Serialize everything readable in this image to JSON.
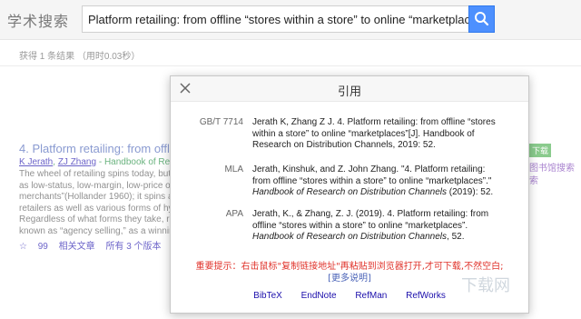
{
  "header": {
    "logo": "学术搜索",
    "search_value": "Platform retailing: from offline “stores within a store” to online “marketplaces” online"
  },
  "stats": "获得 1 条结果 （用时0.03秒）",
  "result": {
    "title": "4. Platform retailing: from offli",
    "authors": [
      "K Jerath",
      "ZJ Zhang"
    ],
    "source": " - Handbook of Rese",
    "snippet": [
      "The wheel of retailing spins today, but",
      "as low-status, low-margin, low-price op",
      "merchants”(Hollander 1960); it spins a",
      "retailers as well as various forms of hy",
      "Regardless of what forms they take, r",
      "known as “agency selling,” as a winnin"
    ],
    "actions": [
      "☆",
      "99",
      "相关文章",
      "所有 3 个版本"
    ],
    "side_badge": "下载",
    "side_link": "图书馆搜索",
    "side_link2": "索"
  },
  "modal": {
    "title": "引用",
    "citations": [
      {
        "format": "GB/T 7714",
        "lines": [
          "Jerath K, Zhang Z J. 4. Platform retailing: from offline “stores",
          "within a store” to online “marketplaces”[J]. Handbook of",
          "Research on Distribution Channels, 2019: 52."
        ]
      },
      {
        "format": "MLA",
        "lines": [
          "Jerath, Kinshuk, and Z. John Zhang. \"4. Platform retailing:",
          "from offline “stores within a store” to online “marketplaces”.\""
        ],
        "italic_line": "Handbook of Research on Distribution Channels",
        "italic_suffix": " (2019): 52."
      },
      {
        "format": "APA",
        "lines": [
          "Jerath, K., & Zhang, Z. J. (2019). 4. Platform retailing: from",
          "offline “stores within a store” to online “marketplaces”."
        ],
        "italic_line": "Handbook of Research on Distribution Channels",
        "italic_suffix": ", 52."
      }
    ],
    "notice": "重要提示：右击鼠标\"复制链接地址\"再粘贴到浏览器打开,才可下载,不然空白;",
    "more_link": "[更多说明]",
    "exports": [
      "BibTeX",
      "EndNote",
      "RefMan",
      "RefWorks"
    ]
  },
  "watermark": "下载网"
}
